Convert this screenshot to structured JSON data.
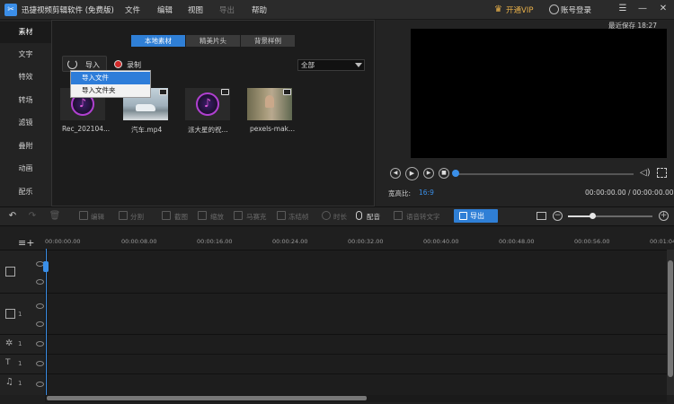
{
  "titlebar": {
    "title": "迅捷视频剪辑软件 (免费版)",
    "menus": [
      "文件",
      "编辑",
      "视图",
      "导出",
      "帮助"
    ],
    "vip": "开通VIP",
    "account": "账号登录"
  },
  "sidebar": {
    "items": [
      "素材",
      "文字",
      "特效",
      "转场",
      "滤镜",
      "叠附",
      "动画",
      "配乐"
    ]
  },
  "media": {
    "tabs": [
      "本地素材",
      "精美片头",
      "背景样例"
    ],
    "import_label": "导入",
    "record_label": "录制",
    "filter_value": "全部",
    "dropdown": [
      "导入文件",
      "导入文件夹"
    ],
    "items": [
      {
        "name": "Rec_202104...",
        "type": "music"
      },
      {
        "name": "汽车.mp4",
        "type": "video"
      },
      {
        "name": "派大星的祝...",
        "type": "music"
      },
      {
        "name": "pexels-mak...",
        "type": "video"
      }
    ]
  },
  "preview": {
    "save_status": "最近保存 18:27",
    "ratio_label": "宽高比:",
    "ratio_value": "16:9",
    "time": "00:00:00.00 / 00:00:00.00"
  },
  "toolbar": {
    "tools": [
      "编辑",
      "分割",
      "截图",
      "缩放",
      "马赛克",
      "冻结帧",
      "时长",
      "配音",
      "语音转文字"
    ],
    "export_label": "导出"
  },
  "timeline": {
    "ticks": [
      "00:00:00.00",
      "00:00:08.00",
      "00:00:16.00",
      "00:00:24.00",
      "00:00:32.00",
      "00:00:40.00",
      "00:00:48.00",
      "00:00:56.00",
      "00:01:04"
    ],
    "track_nums": [
      "1",
      "1",
      "1",
      "1"
    ]
  },
  "colors": {
    "accent": "#2f7fd6",
    "vip": "#e8b04a"
  }
}
